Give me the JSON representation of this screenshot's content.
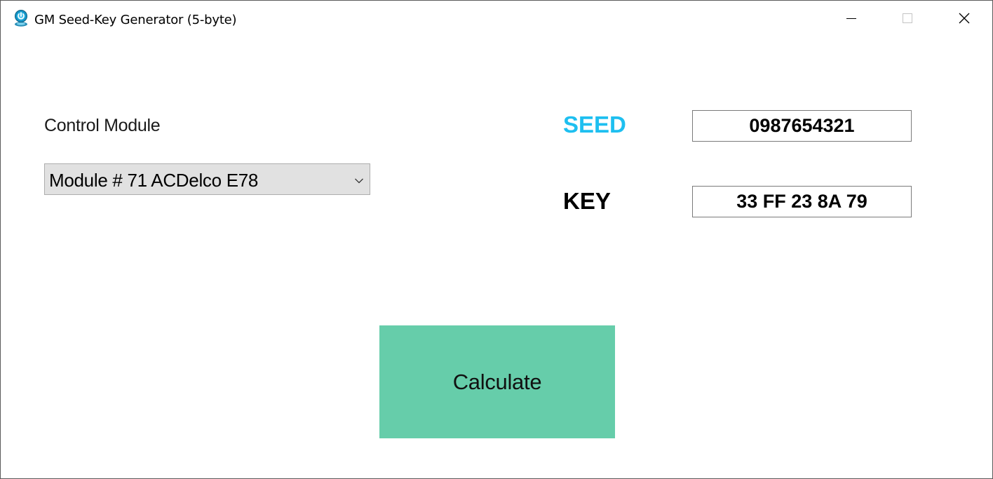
{
  "window": {
    "title": "GM Seed-Key Generator (5-byte)"
  },
  "form": {
    "control_module_label": "Control Module",
    "control_module_selected": "Module # 71 ACDelco E78",
    "seed_label": "SEED",
    "seed_value": "0987654321",
    "key_label": "KEY",
    "key_value": "33 FF 23 8A 79",
    "calculate_label": "Calculate"
  },
  "icons": {
    "app": "app-logo-icon",
    "minimize": "minimize-icon",
    "maximize": "maximize-icon",
    "close": "close-icon",
    "dropdown": "chevron-down-icon"
  },
  "colors": {
    "seed_label": "#1ebff0",
    "calculate_button": "#66cdaa",
    "combo_background": "#e1e1e1"
  }
}
